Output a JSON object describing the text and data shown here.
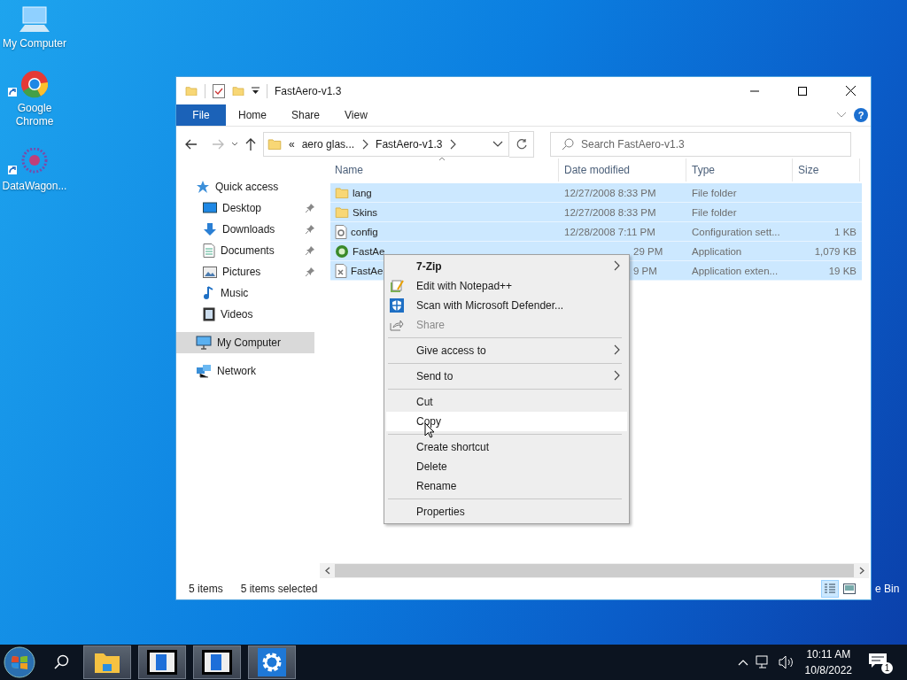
{
  "desktop": {
    "icons": [
      {
        "kind": "computer",
        "label": "My Computer",
        "shortcut": false
      },
      {
        "kind": "browser",
        "label": "Google Chrome",
        "shortcut": true
      },
      {
        "kind": "app",
        "label": "DataWagon...",
        "shortcut": true
      }
    ],
    "peek_label": "e Bin"
  },
  "window": {
    "title": "FastAero-v1.3",
    "ribbon": {
      "file_button": "File",
      "tabs": [
        {
          "label": "Home",
          "selected": false
        },
        {
          "label": "Share",
          "selected": false
        },
        {
          "label": "View",
          "selected": false
        }
      ],
      "help": "?"
    },
    "address": {
      "overflow": "«",
      "crumbs": [
        "aero glas...",
        "FastAero-v1.3"
      ]
    },
    "search": {
      "placeholder": "Search FastAero-v1.3"
    },
    "sidebar": {
      "items": [
        {
          "kind": "star",
          "label": "Quick access",
          "selected": false,
          "children": [
            {
              "kind": "desktop",
              "label": "Desktop",
              "pinned": true,
              "selected": false
            },
            {
              "kind": "download",
              "label": "Downloads",
              "pinned": true,
              "selected": false
            },
            {
              "kind": "document",
              "label": "Documents",
              "pinned": true,
              "selected": false
            },
            {
              "kind": "picture",
              "label": "Pictures",
              "pinned": true,
              "selected": false
            },
            {
              "kind": "music",
              "label": "Music",
              "pinned": false,
              "selected": false
            },
            {
              "kind": "video",
              "label": "Videos",
              "pinned": false,
              "selected": false
            }
          ]
        },
        {
          "kind": "computer",
          "label": "My Computer",
          "selected": true
        },
        {
          "kind": "network",
          "label": "Network",
          "selected": false
        }
      ]
    },
    "files": {
      "columns": [
        "Name",
        "Date modified",
        "Type",
        "Size"
      ],
      "rows": [
        {
          "kind": "folder",
          "name": "lang",
          "date": "12/27/2008 8:33 PM",
          "type": "File folder",
          "size": "",
          "selected": true,
          "covered": false
        },
        {
          "kind": "folder",
          "name": "Skins",
          "date": "12/27/2008 8:33 PM",
          "type": "File folder",
          "size": "",
          "selected": true,
          "covered": false
        },
        {
          "kind": "config",
          "name": "config",
          "date": "12/28/2008 7:11 PM",
          "type": "Configuration sett...",
          "size": "1 KB",
          "selected": true,
          "covered": false
        },
        {
          "kind": "app",
          "name": "FastAe",
          "date": "29 PM",
          "type": "Application",
          "size": "1,079 KB",
          "selected": true,
          "covered": true
        },
        {
          "kind": "dll",
          "name": "FastAe",
          "date": "9 PM",
          "type": "Application exten...",
          "size": "19 KB",
          "selected": true,
          "covered": true
        }
      ]
    },
    "status": {
      "count": "5 items",
      "selection": "5 items selected",
      "views": [
        {
          "kind": "details",
          "selected": true
        },
        {
          "kind": "large",
          "selected": false
        }
      ]
    }
  },
  "context_menu": {
    "groups": [
      [
        {
          "label": "7-Zip",
          "kind": "none",
          "default": true,
          "submenu": true,
          "disabled": false,
          "selected": false
        },
        {
          "label": "Edit with Notepad++",
          "kind": "notepad",
          "default": false,
          "submenu": false,
          "disabled": false,
          "selected": false
        },
        {
          "label": "Scan with Microsoft Defender...",
          "kind": "shield",
          "default": false,
          "submenu": false,
          "disabled": false,
          "selected": false
        },
        {
          "label": "Share",
          "kind": "share",
          "default": false,
          "submenu": false,
          "disabled": true,
          "selected": false
        }
      ],
      [
        {
          "label": "Give access to",
          "kind": "none",
          "default": false,
          "submenu": true,
          "disabled": false,
          "selected": false
        }
      ],
      [
        {
          "label": "Send to",
          "kind": "none",
          "default": false,
          "submenu": true,
          "disabled": false,
          "selected": false
        }
      ],
      [
        {
          "label": "Cut",
          "kind": "none",
          "default": false,
          "submenu": false,
          "disabled": false,
          "selected": false
        },
        {
          "label": "Copy",
          "kind": "none",
          "default": false,
          "submenu": false,
          "disabled": false,
          "selected": true
        }
      ],
      [
        {
          "label": "Create shortcut",
          "kind": "none",
          "default": false,
          "submenu": false,
          "disabled": false,
          "selected": false
        },
        {
          "label": "Delete",
          "kind": "none",
          "default": false,
          "submenu": false,
          "disabled": false,
          "selected": false
        },
        {
          "label": "Rename",
          "kind": "none",
          "default": false,
          "submenu": false,
          "disabled": false,
          "selected": false
        }
      ],
      [
        {
          "label": "Properties",
          "kind": "none",
          "default": false,
          "submenu": false,
          "disabled": false,
          "selected": false
        }
      ]
    ]
  },
  "taskbar": {
    "apps": [
      {
        "kind": "explorer"
      },
      {
        "kind": "window"
      },
      {
        "kind": "window"
      },
      {
        "kind": "settings"
      }
    ],
    "time": "10:11 AM",
    "date": "10/8/2022",
    "notifications": "1"
  }
}
